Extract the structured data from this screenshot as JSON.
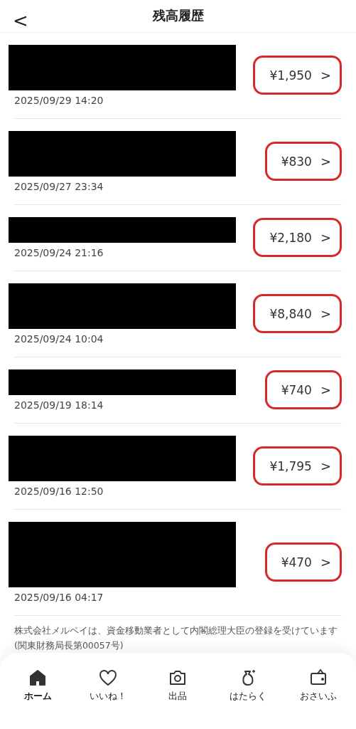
{
  "header": {
    "back": "<",
    "title": "残高履歴"
  },
  "transactions": [
    {
      "kind": "double",
      "date": "2025/09/29 14:20",
      "amount": "¥1,950",
      "chevron": ">",
      "circled": true
    },
    {
      "kind": "double",
      "date": "2025/09/27 23:34",
      "amount": "¥830",
      "chevron": ">",
      "circled": true
    },
    {
      "kind": "single",
      "date": "2025/09/24 21:16",
      "amount": "¥2,180",
      "chevron": ">",
      "circled": true
    },
    {
      "kind": "double",
      "date": "2025/09/24 10:04",
      "amount": "¥8,840",
      "chevron": ">",
      "circled": true
    },
    {
      "kind": "single",
      "date": "2025/09/19 18:14",
      "amount": "¥740",
      "chevron": ">",
      "circled": true
    },
    {
      "kind": "double",
      "date": "2025/09/16 12:50",
      "amount": "¥1,795",
      "chevron": ">",
      "circled": true
    },
    {
      "kind": "triple",
      "date": "2025/09/16 04:17",
      "amount": "¥470",
      "chevron": ">",
      "circled": true
    }
  ],
  "notice": "株式会社メルペイは、資金移動業者として内閣総理大臣の登録を受けています (関東財務局長第00057号)",
  "tab_bar": [
    {
      "kind": "home",
      "label": "ホーム",
      "selected": true
    },
    {
      "kind": "heart",
      "label": "いいね！",
      "selected": false
    },
    {
      "kind": "camera",
      "label": "出品",
      "selected": false
    },
    {
      "kind": "bag",
      "label": "はたらく",
      "selected": false
    },
    {
      "kind": "wallet",
      "label": "おさいふ",
      "selected": false
    }
  ]
}
